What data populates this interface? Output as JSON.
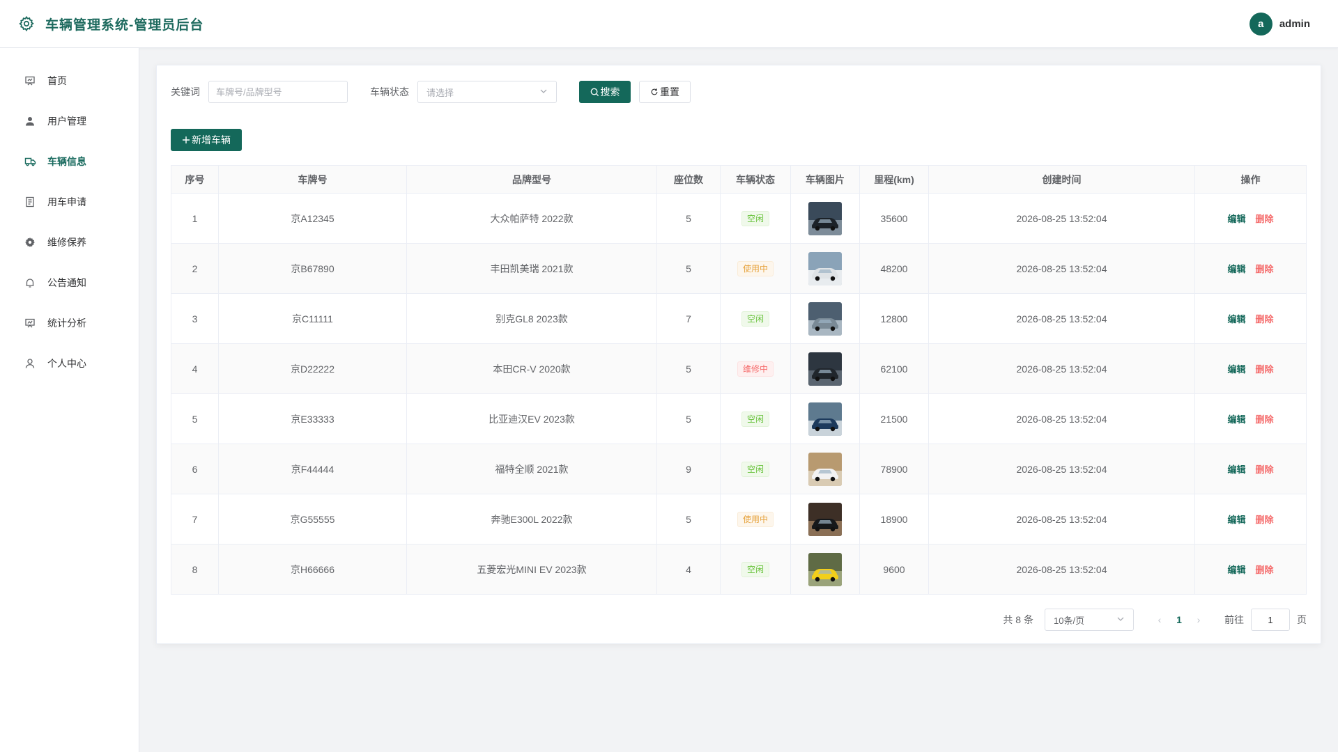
{
  "header": {
    "title": "车辆管理系统-管理员后台",
    "user_initial": "a",
    "username": "admin"
  },
  "sidebar": {
    "items": [
      {
        "label": "首页",
        "icon": "dashboard-icon",
        "active": false
      },
      {
        "label": "用户管理",
        "icon": "user-icon",
        "active": false
      },
      {
        "label": "车辆信息",
        "icon": "truck-icon",
        "active": true
      },
      {
        "label": "用车申请",
        "icon": "document-icon",
        "active": false
      },
      {
        "label": "维修保养",
        "icon": "gear-icon",
        "active": false
      },
      {
        "label": "公告通知",
        "icon": "bell-icon",
        "active": false
      },
      {
        "label": "统计分析",
        "icon": "chart-icon",
        "active": false
      },
      {
        "label": "个人中心",
        "icon": "person-icon",
        "active": false
      }
    ]
  },
  "filter": {
    "keyword_label": "关键词",
    "keyword_placeholder": "车牌号/品牌型号",
    "keyword_value": "",
    "status_label": "车辆状态",
    "status_placeholder": "请选择",
    "search_button": "搜索",
    "reset_button": "重置"
  },
  "add_button": "新增车辆",
  "table": {
    "columns": [
      "序号",
      "车牌号",
      "品牌型号",
      "座位数",
      "车辆状态",
      "车辆图片",
      "里程(km)",
      "创建时间",
      "操作"
    ],
    "edit_label": "编辑",
    "delete_label": "删除",
    "rows": [
      {
        "index": "1",
        "plate": "京A12345",
        "model": "大众帕萨特 2022款",
        "seats": "5",
        "status": "空闲",
        "status_type": "free",
        "mileage": "35600",
        "created": "2026-08-25 13:52:04",
        "photo": "car-photo-dark-sedan"
      },
      {
        "index": "2",
        "plate": "京B67890",
        "model": "丰田凯美瑞 2021款",
        "seats": "5",
        "status": "使用中",
        "status_type": "use",
        "mileage": "48200",
        "created": "2026-08-25 13:52:04",
        "photo": "car-photo-white-sedan"
      },
      {
        "index": "3",
        "plate": "京C11111",
        "model": "别克GL8 2023款",
        "seats": "7",
        "status": "空闲",
        "status_type": "free",
        "mileage": "12800",
        "created": "2026-08-25 13:52:04",
        "photo": "car-photo-silver-car"
      },
      {
        "index": "4",
        "plate": "京D22222",
        "model": "本田CR-V 2020款",
        "seats": "5",
        "status": "维修中",
        "status_type": "fix",
        "mileage": "62100",
        "created": "2026-08-25 13:52:04",
        "photo": "car-photo-dark-suv"
      },
      {
        "index": "5",
        "plate": "京E33333",
        "model": "比亚迪汉EV 2023款",
        "seats": "5",
        "status": "空闲",
        "status_type": "free",
        "mileage": "21500",
        "created": "2026-08-25 13:52:04",
        "photo": "car-photo-blue-sedan"
      },
      {
        "index": "6",
        "plate": "京F44444",
        "model": "福特全顺 2021款",
        "seats": "9",
        "status": "空闲",
        "status_type": "free",
        "mileage": "78900",
        "created": "2026-08-25 13:52:04",
        "photo": "car-photo-white-van"
      },
      {
        "index": "7",
        "plate": "京G55555",
        "model": "奔驰E300L 2022款",
        "seats": "5",
        "status": "使用中",
        "status_type": "use",
        "mileage": "18900",
        "created": "2026-08-25 13:52:04",
        "photo": "car-photo-black-sedan"
      },
      {
        "index": "8",
        "plate": "京H66666",
        "model": "五菱宏光MINI EV 2023款",
        "seats": "4",
        "status": "空闲",
        "status_type": "free",
        "mileage": "9600",
        "created": "2026-08-25 13:52:04",
        "photo": "car-photo-yellow-mini"
      }
    ]
  },
  "pagination": {
    "total_text": "共 8 条",
    "page_size": "10条/页",
    "current_page": "1",
    "goto_label": "前往",
    "goto_value": "1",
    "page_suffix": "页"
  },
  "colors": {
    "primary": "#14685a",
    "danger": "#f56c6c",
    "warning": "#e6a23c",
    "success": "#67c23a"
  }
}
